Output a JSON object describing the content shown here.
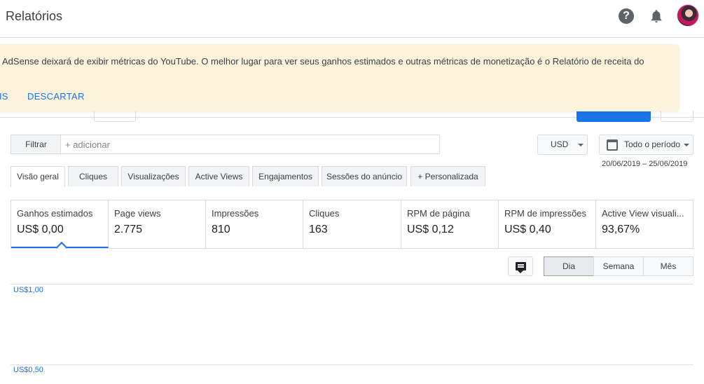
{
  "header": {
    "title": "Relatórios",
    "help_icon": "help-circle-icon",
    "bell_icon": "notifications-icon"
  },
  "banner": {
    "text": "le AdSense deixará de exibir métricas do YouTube. O melhor lugar para ver seus ganhos estimados e outras métricas de monetização é o Relatório de receita do",
    "learn_more": "AIS",
    "dismiss": "DESCARTAR"
  },
  "filter": {
    "label": "Filtrar",
    "placeholder": "+ adicionar"
  },
  "currency": {
    "value": "USD"
  },
  "date": {
    "label": "Todo o período",
    "range": "20/06/2019 – 25/06/2019"
  },
  "tabs": [
    {
      "label": "Visão geral"
    },
    {
      "label": "Cliques"
    },
    {
      "label": "Visualizações"
    },
    {
      "label": "Active Views"
    },
    {
      "label": "Engajamentos"
    },
    {
      "label": "Sessões do anúncio"
    },
    {
      "label": "+ Personalizada"
    }
  ],
  "metrics": [
    {
      "label": "Ganhos estimados",
      "value": "US$ 0,00"
    },
    {
      "label": "Page views",
      "value": "2.775"
    },
    {
      "label": "Impressões",
      "value": "810"
    },
    {
      "label": "Cliques",
      "value": "163"
    },
    {
      "label": "RPM de página",
      "value": "US$ 0,12"
    },
    {
      "label": "RPM de impressões",
      "value": "US$ 0,40"
    },
    {
      "label": "Active View visuali...",
      "value": "93,67%"
    }
  ],
  "granularity": {
    "day": "Dia",
    "week": "Semana",
    "month": "Mês"
  },
  "chart": {
    "y_labels": [
      "US$1,00",
      "US$0,50"
    ]
  },
  "colors": {
    "accent": "#1a73e8",
    "banner_bg": "#fdf3dc"
  }
}
